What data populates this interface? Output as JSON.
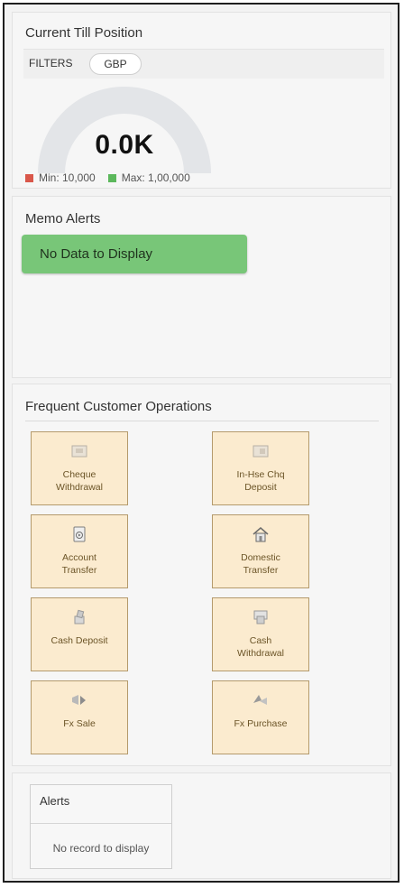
{
  "till": {
    "title": "Current Till Position",
    "filters_label": "FILTERS",
    "currency": "GBP",
    "gauge_value": "0.0K",
    "gauge_fraction": 0,
    "min_label": "Min: 10,000",
    "max_label": "Max: 1,00,000",
    "colors": {
      "min": "#d9574a",
      "max": "#5cb85c",
      "track": "#e3e5e8"
    }
  },
  "memo": {
    "title": "Memo Alerts",
    "no_data": "No Data to Display"
  },
  "operations": {
    "title": "Frequent Customer Operations",
    "items": [
      {
        "line1": "Cheque",
        "line2": "Withdrawal",
        "icon": "cheque-icon"
      },
      {
        "line1": "In-Hse Chq",
        "line2": "Deposit",
        "icon": "cheque-deposit-icon"
      },
      {
        "line1": "Account",
        "line2": "Transfer",
        "icon": "account-transfer-icon"
      },
      {
        "line1": "Domestic",
        "line2": "Transfer",
        "icon": "house-icon"
      },
      {
        "line1": "Cash Deposit",
        "line2": "",
        "icon": "cash-deposit-icon"
      },
      {
        "line1": "Cash",
        "line2": "Withdrawal",
        "icon": "cash-withdrawal-icon"
      },
      {
        "line1": "Fx Sale",
        "line2": "",
        "icon": "fx-sale-icon"
      },
      {
        "line1": "Fx Purchase",
        "line2": "",
        "icon": "fx-purchase-icon"
      }
    ]
  },
  "alerts": {
    "title": "Alerts",
    "empty": "No record to display"
  }
}
